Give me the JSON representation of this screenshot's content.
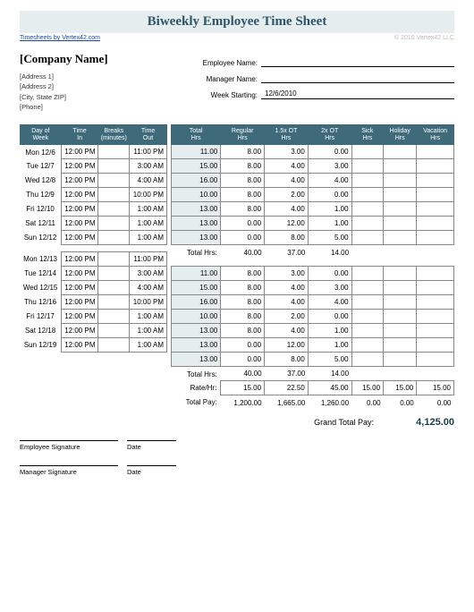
{
  "title": "Biweekly Employee Time Sheet",
  "link_text": "Timesheets by Vertex42.com",
  "copyright": "© 2010 Vertex42 LLC",
  "company_name": "[Company Name]",
  "address": [
    "[Address 1]",
    "[Address 2]",
    "[City, State  ZIP]",
    "[Phone]"
  ],
  "fields": {
    "emp_label": "Employee Name:",
    "emp_val": "",
    "mgr_label": "Manager Name:",
    "mgr_val": "",
    "week_label": "Week Starting:",
    "week_val": "12/6/2010"
  },
  "left_headers": [
    "Day of Week",
    "Time In",
    "Breaks (minutes)",
    "Time Out"
  ],
  "right_headers": [
    "Total Hrs",
    "Regular Hrs",
    "1.5x OT Hrs",
    "2x OT Hrs",
    "Sick Hrs",
    "Holiday Hrs",
    "Vacation Hrs"
  ],
  "week1": [
    {
      "day": "Mon 12/6",
      "in": "12:00 PM",
      "br": "",
      "out": "11:00 PM",
      "tot": "11.00",
      "reg": "8.00",
      "ot15": "3.00",
      "ot2": "0.00",
      "sick": "",
      "hol": "",
      "vac": ""
    },
    {
      "day": "Tue 12/7",
      "in": "12:00 PM",
      "br": "",
      "out": "3:00 AM",
      "tot": "15.00",
      "reg": "8.00",
      "ot15": "4.00",
      "ot2": "3.00",
      "sick": "",
      "hol": "",
      "vac": ""
    },
    {
      "day": "Wed 12/8",
      "in": "12:00 PM",
      "br": "",
      "out": "4:00 AM",
      "tot": "16.00",
      "reg": "8.00",
      "ot15": "4.00",
      "ot2": "4.00",
      "sick": "",
      "hol": "",
      "vac": ""
    },
    {
      "day": "Thu 12/9",
      "in": "12:00 PM",
      "br": "",
      "out": "10:00 PM",
      "tot": "10.00",
      "reg": "8.00",
      "ot15": "2.00",
      "ot2": "0.00",
      "sick": "",
      "hol": "",
      "vac": ""
    },
    {
      "day": "Fri 12/10",
      "in": "12:00 PM",
      "br": "",
      "out": "1:00 AM",
      "tot": "13.00",
      "reg": "8.00",
      "ot15": "4.00",
      "ot2": "1.00",
      "sick": "",
      "hol": "",
      "vac": ""
    },
    {
      "day": "Sat 12/11",
      "in": "12:00 PM",
      "br": "",
      "out": "1:00 AM",
      "tot": "13.00",
      "reg": "0.00",
      "ot15": "12.00",
      "ot2": "1.00",
      "sick": "",
      "hol": "",
      "vac": ""
    },
    {
      "day": "Sun 12/12",
      "in": "12:00 PM",
      "br": "",
      "out": "1:00 AM",
      "tot": "13.00",
      "reg": "0.00",
      "ot15": "8.00",
      "ot2": "5.00",
      "sick": "",
      "hol": "",
      "vac": ""
    }
  ],
  "week1_totals": {
    "label": "Total Hrs:",
    "reg": "40.00",
    "ot15": "37.00",
    "ot2": "14.00",
    "sick": "",
    "hol": "",
    "vac": ""
  },
  "week2": [
    {
      "day": "Mon 12/13",
      "in": "12:00 PM",
      "br": "",
      "out": "11:00 PM",
      "tot": "11.00",
      "reg": "8.00",
      "ot15": "3.00",
      "ot2": "0.00",
      "sick": "",
      "hol": "",
      "vac": ""
    },
    {
      "day": "Tue 12/14",
      "in": "12:00 PM",
      "br": "",
      "out": "3:00 AM",
      "tot": "15.00",
      "reg": "8.00",
      "ot15": "4.00",
      "ot2": "3.00",
      "sick": "",
      "hol": "",
      "vac": ""
    },
    {
      "day": "Wed 12/15",
      "in": "12:00 PM",
      "br": "",
      "out": "4:00 AM",
      "tot": "16.00",
      "reg": "8.00",
      "ot15": "4.00",
      "ot2": "4.00",
      "sick": "",
      "hol": "",
      "vac": ""
    },
    {
      "day": "Thu 12/16",
      "in": "12:00 PM",
      "br": "",
      "out": "10:00 PM",
      "tot": "10.00",
      "reg": "8.00",
      "ot15": "2.00",
      "ot2": "0.00",
      "sick": "",
      "hol": "",
      "vac": ""
    },
    {
      "day": "Fri 12/17",
      "in": "12:00 PM",
      "br": "",
      "out": "1:00 AM",
      "tot": "13.00",
      "reg": "8.00",
      "ot15": "4.00",
      "ot2": "1.00",
      "sick": "",
      "hol": "",
      "vac": ""
    },
    {
      "day": "Sat 12/18",
      "in": "12:00 PM",
      "br": "",
      "out": "1:00 AM",
      "tot": "13.00",
      "reg": "0.00",
      "ot15": "12.00",
      "ot2": "1.00",
      "sick": "",
      "hol": "",
      "vac": ""
    },
    {
      "day": "Sun 12/19",
      "in": "12:00 PM",
      "br": "",
      "out": "1:00 AM",
      "tot": "13.00",
      "reg": "0.00",
      "ot15": "8.00",
      "ot2": "5.00",
      "sick": "",
      "hol": "",
      "vac": ""
    }
  ],
  "week2_totals": {
    "label": "Total Hrs:",
    "reg": "40.00",
    "ot15": "37.00",
    "ot2": "14.00",
    "sick": "",
    "hol": "",
    "vac": ""
  },
  "rate": {
    "label": "Rate/Hr:",
    "reg": "15.00",
    "ot15": "22.50",
    "ot2": "45.00",
    "sick": "15.00",
    "hol": "15.00",
    "vac": "15.00"
  },
  "pay": {
    "label": "Total Pay:",
    "reg": "1,200.00",
    "ot15": "1,665.00",
    "ot2": "1,260.00",
    "sick": "0.00",
    "hol": "0.00",
    "vac": "0.00"
  },
  "sig": {
    "emp": "Employee Signature",
    "date": "Date",
    "mgr": "Manager Signature"
  },
  "grand": {
    "label": "Grand Total Pay:",
    "val": "4,125.00"
  }
}
